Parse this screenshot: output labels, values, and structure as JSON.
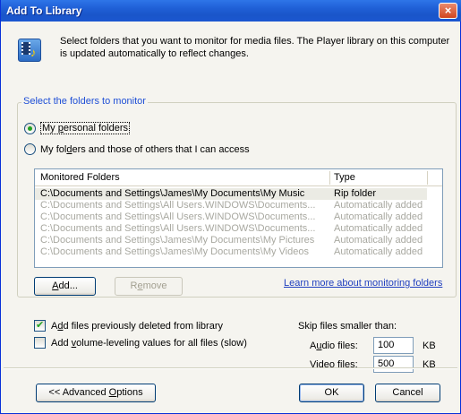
{
  "window": {
    "title": "Add To Library",
    "close_label": "×"
  },
  "header": {
    "icon": "media-library-icon",
    "text": "Select folders that you want to monitor for media files. The Player library on this computer is updated automatically to reflect changes."
  },
  "group": {
    "legend": "Select the folders to monitor",
    "radio_personal_pre": "My ",
    "radio_personal_u": "p",
    "radio_personal_post": "ersonal folders",
    "radio_others_pre": "My fol",
    "radio_others_u": "d",
    "radio_others_post": "ers and those of others that I can access",
    "selected_radio": "personal"
  },
  "list": {
    "headers": [
      "Monitored Folders",
      "Type"
    ],
    "rows": [
      {
        "folder": "C:\\Documents and Settings\\James\\My Documents\\My Music",
        "type": "Rip folder"
      },
      {
        "folder": "C:\\Documents and Settings\\All Users.WINDOWS\\Documents...",
        "type": "Automatically added"
      },
      {
        "folder": "C:\\Documents and Settings\\All Users.WINDOWS\\Documents...",
        "type": "Automatically added"
      },
      {
        "folder": "C:\\Documents and Settings\\All Users.WINDOWS\\Documents...",
        "type": "Automatically added"
      },
      {
        "folder": "C:\\Documents and Settings\\James\\My Documents\\My Pictures",
        "type": "Automatically added"
      },
      {
        "folder": "C:\\Documents and Settings\\James\\My Documents\\My Videos",
        "type": "Automatically added"
      }
    ]
  },
  "buttons": {
    "add_u": "A",
    "add_post": "dd...",
    "remove_pre": "R",
    "remove_u": "e",
    "remove_post": "move",
    "advanced_pre": "<< Advanced ",
    "advanced_u": "O",
    "advanced_post": "ptions",
    "ok": "OK",
    "cancel": "Cancel"
  },
  "link": {
    "text": "Learn more about monitoring folders"
  },
  "options": {
    "deleted_pre": "A",
    "deleted_u": "d",
    "deleted_post": "d files previously deleted from library",
    "deleted_checked": true,
    "volume_pre": "Add ",
    "volume_u": "v",
    "volume_post": "olume-leveling values for all files (slow)",
    "volume_checked": false
  },
  "skip": {
    "title": "Skip files smaller than:",
    "audio_pre": "A",
    "audio_u": "u",
    "audio_post": "dio files:",
    "audio_value": "100",
    "video_pre": "V",
    "video_u": "i",
    "video_post": "deo files:",
    "video_value": "500",
    "unit": "KB"
  }
}
